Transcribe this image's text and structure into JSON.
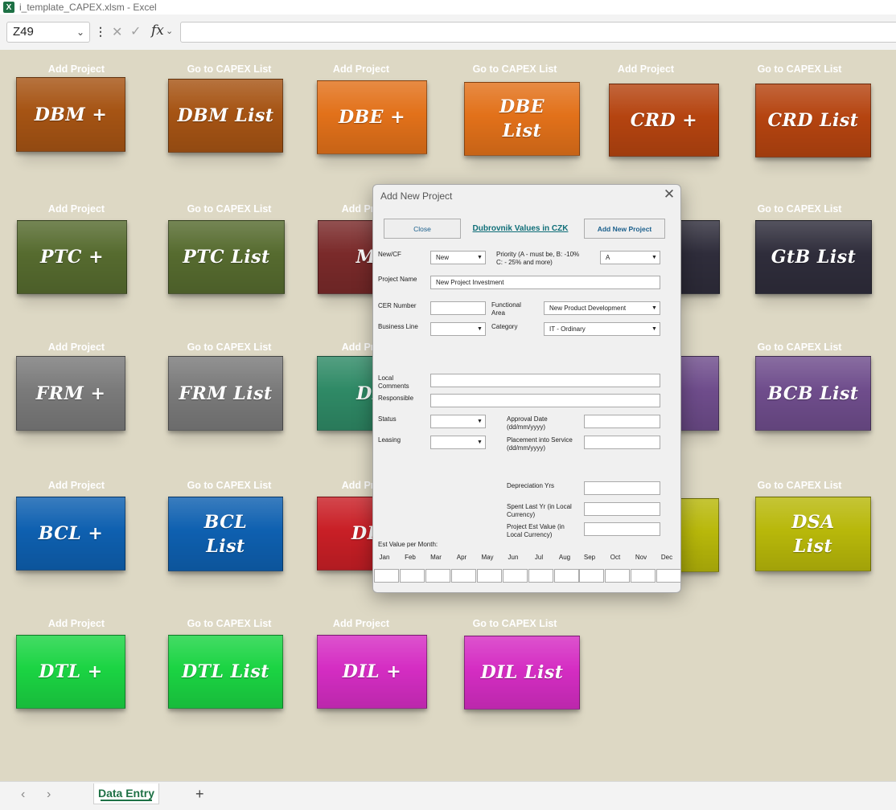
{
  "window": {
    "title": "i_template_CAPEX.xlsm - Excel",
    "app_icon": "excel-icon"
  },
  "formula_bar": {
    "name_box": "Z49",
    "fx_label": "fx",
    "formula": ""
  },
  "tiles": [
    {
      "caption": "Add Project",
      "label": "DBM +",
      "color": "#a65414"
    },
    {
      "caption": "Go to CAPEX List",
      "label": "DBM List",
      "color": "#a65414"
    },
    {
      "caption": "Add Project",
      "label": "DBE +",
      "color": "#e2711a"
    },
    {
      "caption": "Go to CAPEX List",
      "label": "DBE\nList",
      "color": "#e2711a"
    },
    {
      "caption": "Add Project",
      "label": "CRD +",
      "color": "#b54410"
    },
    {
      "caption": "Go to CAPEX List",
      "label": "CRD List",
      "color": "#b54410"
    },
    {
      "caption": "Add Project",
      "label": "PTC +",
      "color": "#566b2f"
    },
    {
      "caption": "Go to CAPEX List",
      "label": "PTC List",
      "color": "#566b2f"
    },
    {
      "caption": "Add Pro",
      "label": "MT",
      "color": "#7a2a2a"
    },
    {
      "caption": "",
      "label": "+",
      "color": "#2f2d3b"
    },
    {
      "caption": "Go to CAPEX List",
      "label": "GtB List",
      "color": "#2f2d3b"
    },
    {
      "caption": "Add Project",
      "label": "FRM +",
      "color": "#7a7a7a"
    },
    {
      "caption": "Go to CAPEX List",
      "label": "FRM List",
      "color": "#7a7a7a"
    },
    {
      "caption": "Add Pro",
      "label": "DB",
      "color": "#2f8a66"
    },
    {
      "caption": "",
      "label": "+",
      "color": "#6f4d8c"
    },
    {
      "caption": "Go to CAPEX List",
      "label": "BCB List",
      "color": "#6f4d8c"
    },
    {
      "caption": "Add Project",
      "label": "BCL +",
      "color": "#0e60b0"
    },
    {
      "caption": "Go to CAPEX List",
      "label": "BCL\nList",
      "color": "#0e60b0"
    },
    {
      "caption": "Add Pro",
      "label": "DIU",
      "color": "#c91f26"
    },
    {
      "caption": "",
      "label": "+",
      "color": "#b8b80a"
    },
    {
      "caption": "Go to CAPEX List",
      "label": "DSA\nList",
      "color": "#b8b80a"
    },
    {
      "caption": "Add Project",
      "label": "DTL +",
      "color": "#1bd443"
    },
    {
      "caption": "Go to CAPEX List",
      "label": "DTL List",
      "color": "#1bd443"
    },
    {
      "caption": "Add Project",
      "label": "DIL +",
      "color": "#d52dc3"
    },
    {
      "caption": "Go to CAPEX List",
      "label": "DIL List",
      "color": "#d52dc3"
    }
  ],
  "dialog": {
    "title": "Add New Project",
    "close_icon": "close-icon",
    "close_button": "Close",
    "link": "Dubrovnik Values in CZK",
    "add_button": "Add New Project",
    "new_cf_label": "New/CF",
    "new_cf_value": "New",
    "priority_label": "Priority  (A - must be, B: -10%\nC: - 25% and more)",
    "priority_value": "A",
    "project_name_label": "Project Name",
    "project_name_value": "New Project Investment",
    "cer_label": "CER Number",
    "functional_area_label": "Functional\nArea",
    "functional_area_value": "New Product Development",
    "business_line_label": "Business Line",
    "category_label": "Category",
    "category_value": "IT - Ordinary",
    "local_comments_label": "Local\nComments",
    "responsible_label": "Responsible",
    "status_label": "Status",
    "approval_date_label": "Approval Date\n(dd/mm/yyyy)",
    "leasing_label": "Leasing",
    "placement_label": "Placement into Service\n(dd/mm/yyyy)",
    "depreciation_label": "Depreciation Yrs",
    "spent_label": "Spent Last Yr (in Local\nCurrency)",
    "est_value_label": "Project Est Value (in\nLocal Currency)",
    "per_month_label": "Est Value per Month:",
    "months": [
      "Jan",
      "Feb",
      "Mar",
      "Apr",
      "May",
      "Jun",
      "Jul",
      "Aug",
      "Sep",
      "Oct",
      "Nov",
      "Dec"
    ]
  },
  "sheet_tabs": {
    "active": "Data Entry",
    "add_icon": "plus-icon"
  }
}
